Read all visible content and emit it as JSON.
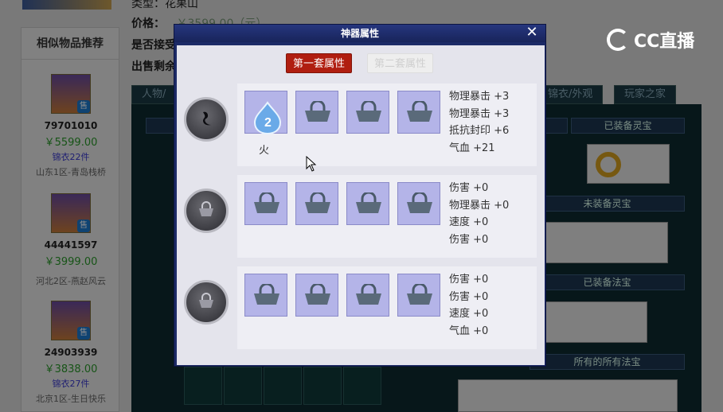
{
  "background": {
    "sidebar_title": "相似物品推荐",
    "info_lines": [
      "类型：花果山",
      "价格：",
      "是否接受",
      "出售剩余"
    ],
    "price_faded": "￥3599.00（元）",
    "recommendations": [
      {
        "id": "79701010",
        "price": "￥5599.00",
        "extra": "锦衣22件",
        "server": "山东1区-青岛栈桥",
        "badge": "售"
      },
      {
        "id": "44441597",
        "price": "￥3999.00",
        "extra": "",
        "server": "河北2区-燕赵风云",
        "badge": "售"
      },
      {
        "id": "24903939",
        "price": "￥3838.00",
        "extra": "锦衣27件",
        "server": "北京1区-生日快乐",
        "badge": "售"
      }
    ],
    "tabs": [
      "人物/",
      "锦衣/外观",
      "玩家之家"
    ],
    "bars": [
      "已装备灵宝",
      "未装备灵宝",
      "已装备法宝",
      "所有的所有法宝"
    ]
  },
  "logo": {
    "text": "CC直播"
  },
  "modal": {
    "title": "神器属性",
    "close_label": "✕",
    "set_buttons": [
      "第一套属性",
      "第二套属性"
    ],
    "rows": [
      {
        "gem_label": "火",
        "attributes": [
          "物理暴击 +3",
          "物理暴击 +3",
          "抵抗封印 +6",
          "气血 +21"
        ]
      },
      {
        "gem_label": "",
        "attributes": [
          "伤害 +0",
          "物理暴击 +0",
          "速度 +0",
          "伤害 +0"
        ]
      },
      {
        "gem_label": "",
        "attributes": [
          "伤害 +0",
          "伤害 +0",
          "速度 +0",
          "气血 +0"
        ]
      }
    ]
  },
  "colors": {
    "modal_frame": "#1c2a66",
    "active_tab": "#b01e10",
    "slot_fill": "#b4b4e8",
    "price_green": "#2a9a2a"
  }
}
